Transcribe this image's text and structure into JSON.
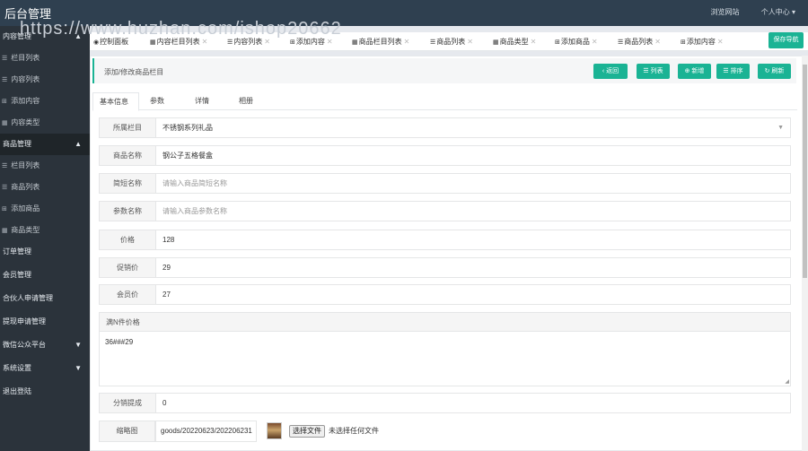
{
  "topbar": {
    "brand": "后台管理",
    "watermark": "https://www.huzhan.com/ishop20662",
    "visit_site": "浏览网站",
    "user_center": "个人中心"
  },
  "sidebar": {
    "groups": [
      {
        "label": "内容管理",
        "expanded": true,
        "items": [
          {
            "icon": "list-icon",
            "label": "栏目列表"
          },
          {
            "icon": "list-icon",
            "label": "内容列表"
          },
          {
            "icon": "plus-square-icon",
            "label": "添加内容"
          },
          {
            "icon": "grid-icon",
            "label": "内容类型"
          }
        ]
      },
      {
        "label": "商品管理",
        "expanded": true,
        "items": [
          {
            "icon": "list-icon",
            "label": "栏目列表"
          },
          {
            "icon": "list-icon",
            "label": "商品列表"
          },
          {
            "icon": "plus-square-icon",
            "label": "添加商品"
          },
          {
            "icon": "grid-icon",
            "label": "商品类型"
          }
        ]
      }
    ],
    "links": [
      "订单管理",
      "会员管理",
      "合伙人申请管理",
      "提现申请管理"
    ],
    "collapsed_groups": [
      "微信公众平台",
      "系统设置"
    ],
    "logout": "退出登陆"
  },
  "tabs": [
    {
      "icon": "dashboard-icon",
      "label": "控制面板"
    },
    {
      "icon": "grid-icon",
      "label": "内容栏目列表"
    },
    {
      "icon": "list-icon",
      "label": "内容列表"
    },
    {
      "icon": "plus-square-icon",
      "label": "添加内容"
    },
    {
      "icon": "grid-icon",
      "label": "商品栏目列表"
    },
    {
      "icon": "list-icon",
      "label": "商品列表"
    },
    {
      "icon": "grid-icon",
      "label": "商品类型"
    },
    {
      "icon": "plus-square-icon",
      "label": "添加商品"
    },
    {
      "icon": "list-icon",
      "label": "商品列表"
    },
    {
      "icon": "plus-square-icon",
      "label": "添加内容"
    }
  ],
  "save_nav": "保存导航",
  "panel": {
    "title": "添加/修改商品栏目",
    "buttons": [
      "返回",
      "列表",
      "新增",
      "排序",
      "刷新"
    ]
  },
  "form_tabs": [
    "基本信息",
    "参数",
    "详情",
    "相册"
  ],
  "fields": {
    "category": {
      "label": "所属栏目",
      "value": "不锈钢系列礼品"
    },
    "name": {
      "label": "商品名称",
      "value": "钢公子五格餐盒"
    },
    "short_name": {
      "label": "简短名称",
      "placeholder": "请输入商品简短名称"
    },
    "param_name": {
      "label": "参数名称",
      "placeholder": "请输入商品参数名称"
    },
    "price": {
      "label": "价格",
      "value": "128"
    },
    "promo_price": {
      "label": "促销价",
      "value": "29"
    },
    "member_price": {
      "label": "会员价",
      "value": "27"
    },
    "n_price": {
      "label": "满N件价格",
      "value": "36###29"
    },
    "commission": {
      "label": "分销提成",
      "value": "0"
    },
    "thumbnail": {
      "label": "缩略图",
      "value": "goods/20220623/202206231",
      "file_button": "选择文件",
      "file_status": "未选择任何文件"
    }
  },
  "colors": {
    "accent": "#1ab394",
    "topbar": "#2f4050",
    "sidebar": "#2b333b"
  }
}
